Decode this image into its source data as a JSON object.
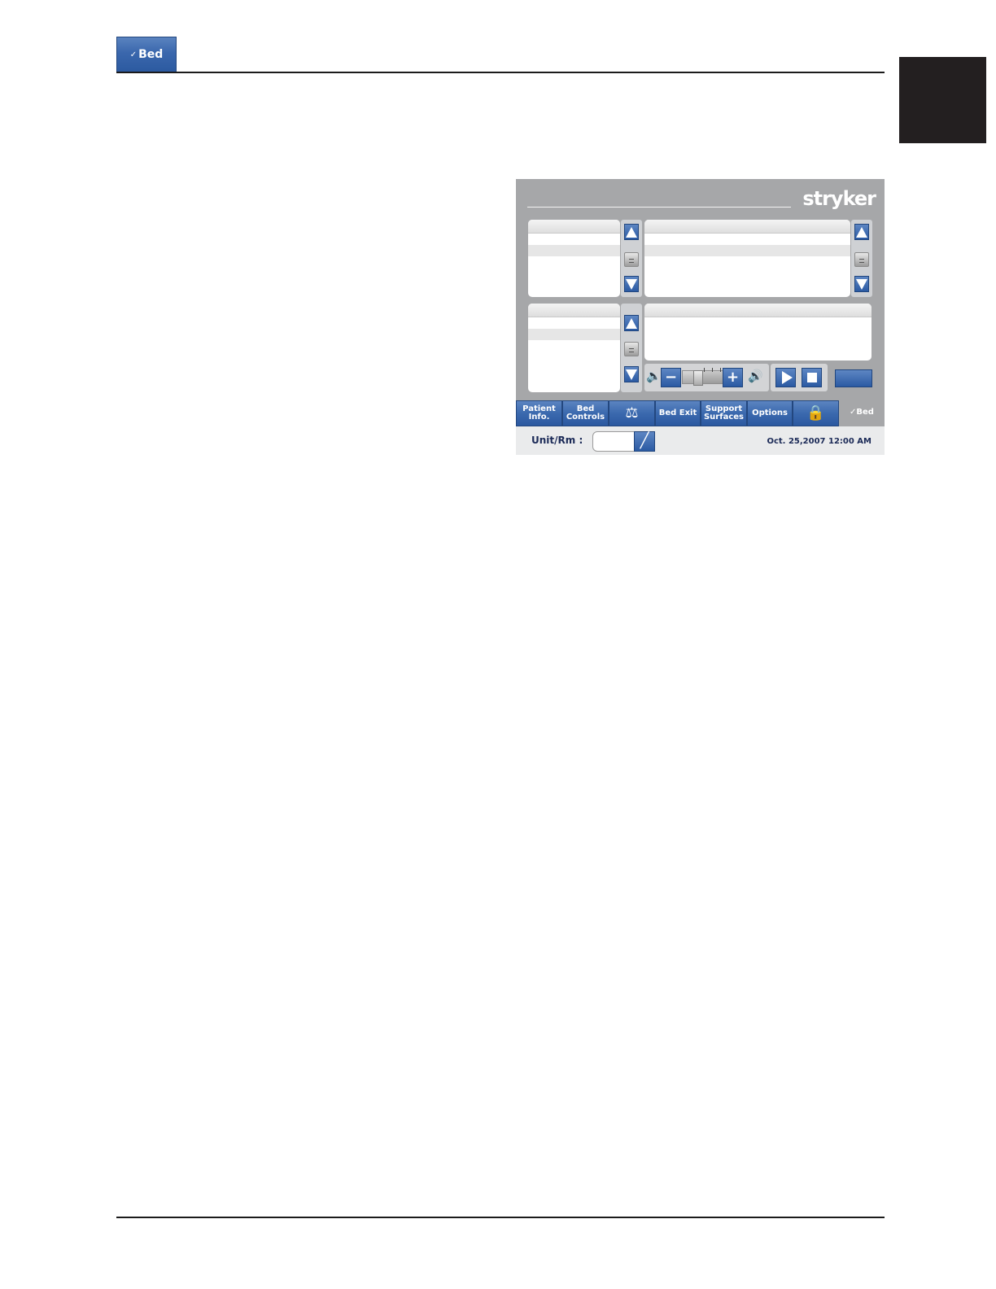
{
  "header": {
    "logo_mark": "✓",
    "logo_label": "Bed"
  },
  "screen": {
    "brand": "stryker",
    "volume": {
      "level": 0.35
    },
    "tabs": [
      {
        "line1": "Patient",
        "line2": "Info."
      },
      {
        "line1": "Bed",
        "line2": "Controls"
      },
      {
        "icon": "scale-icon"
      },
      {
        "line1": "Bed Exit"
      },
      {
        "line1": "Support",
        "line2": "Surfaces"
      },
      {
        "line1": "Options"
      },
      {
        "icon": "lock-icon"
      }
    ],
    "tab_brand_mark": "✓",
    "tab_brand_label": "Bed",
    "footer": {
      "unit_label": "Unit/Rm :",
      "datetime": "Oct. 25,2007  12:00 AM"
    }
  },
  "colors": {
    "button_blue": "#2c5aa0",
    "panel_gray": "#a6a7a9",
    "text_navy": "#1b2a57"
  }
}
